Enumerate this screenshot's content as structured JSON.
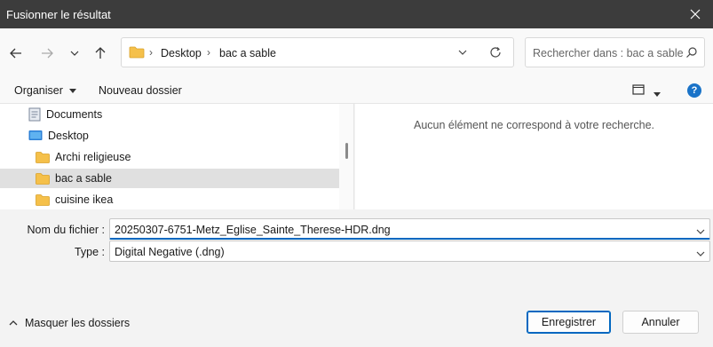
{
  "window": {
    "title": "Fusionner le résultat"
  },
  "nav": {
    "breadcrumb": [
      "Desktop",
      "bac a sable"
    ],
    "search_placeholder": "Rechercher dans : bac a sable"
  },
  "toolbar": {
    "organize": "Organiser",
    "new_folder": "Nouveau dossier",
    "help": "?"
  },
  "tree": [
    {
      "label": "Documents",
      "icon": "documents-icon"
    },
    {
      "label": "Desktop",
      "icon": "desktop-icon"
    },
    {
      "label": "Archi religieuse",
      "icon": "folder-icon"
    },
    {
      "label": "bac a sable",
      "icon": "folder-icon",
      "selected": true
    },
    {
      "label": "cuisine ikea",
      "icon": "folder-icon"
    }
  ],
  "content": {
    "empty_message": "Aucun élément ne correspond à votre recherche."
  },
  "form": {
    "filename_label": "Nom du fichier :",
    "filename_value": "20250307-6751-Metz_Eglise_Sainte_Therese-HDR.dng",
    "type_label": "Type :",
    "type_value": "Digital Negative (.dng)"
  },
  "footer": {
    "hide_folders": "Masquer les dossiers",
    "save": "Enregistrer",
    "cancel": "Annuler"
  },
  "colors": {
    "titlebar": "#3c3c3c",
    "accent": "#0067c0",
    "folder": "#f5c04a",
    "selected_row": "#e0e0e0"
  }
}
